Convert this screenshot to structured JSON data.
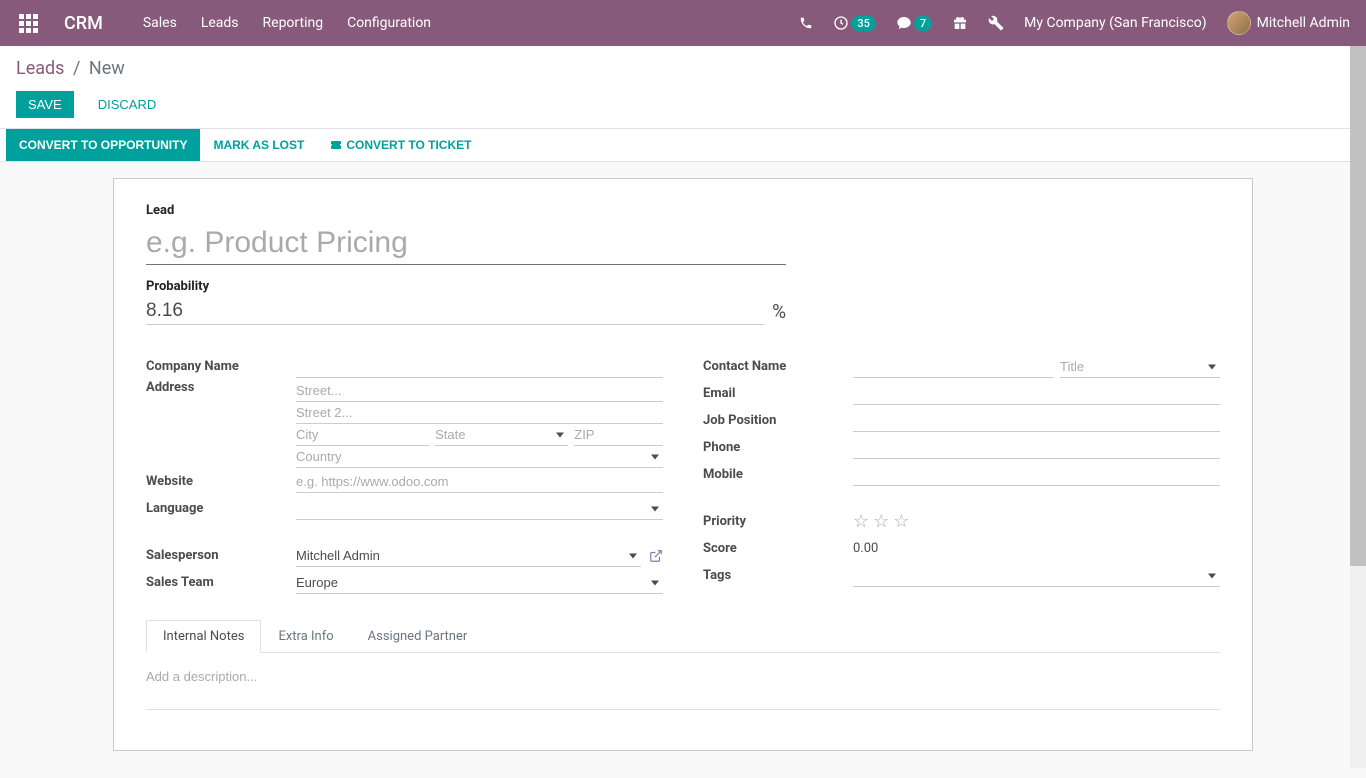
{
  "header": {
    "brand": "CRM",
    "menu": [
      "Sales",
      "Leads",
      "Reporting",
      "Configuration"
    ],
    "activities_badge": "35",
    "messages_badge": "7",
    "company": "My Company (San Francisco)",
    "user": "Mitchell Admin"
  },
  "breadcrumb": {
    "parent": "Leads",
    "current": "New"
  },
  "actions": {
    "save": "Save",
    "discard": "Discard"
  },
  "statusbar": {
    "convert_opp": "Convert to Opportunity",
    "mark_lost": "Mark as Lost",
    "convert_ticket": "Convert to Ticket"
  },
  "form": {
    "lead_label": "Lead",
    "lead_placeholder": "e.g. Product Pricing",
    "probability_label": "Probability",
    "probability_value": "8.16",
    "pct_sign": "%",
    "left": {
      "company_name": "Company Name",
      "address": "Address",
      "street_ph": "Street...",
      "street2_ph": "Street 2...",
      "city_ph": "City",
      "state_ph": "State",
      "zip_ph": "ZIP",
      "country_ph": "Country",
      "website": "Website",
      "website_ph": "e.g. https://www.odoo.com",
      "language": "Language",
      "salesperson": "Salesperson",
      "salesperson_value": "Mitchell Admin",
      "sales_team": "Sales Team",
      "sales_team_value": "Europe"
    },
    "right": {
      "contact_name": "Contact Name",
      "title_ph": "Title",
      "email": "Email",
      "job_position": "Job Position",
      "phone": "Phone",
      "mobile": "Mobile",
      "priority": "Priority",
      "score": "Score",
      "score_value": "0.00",
      "tags": "Tags"
    },
    "tabs": {
      "internal_notes": "Internal Notes",
      "extra_info": "Extra Info",
      "assigned_partner": "Assigned Partner",
      "desc_ph": "Add a description..."
    }
  }
}
